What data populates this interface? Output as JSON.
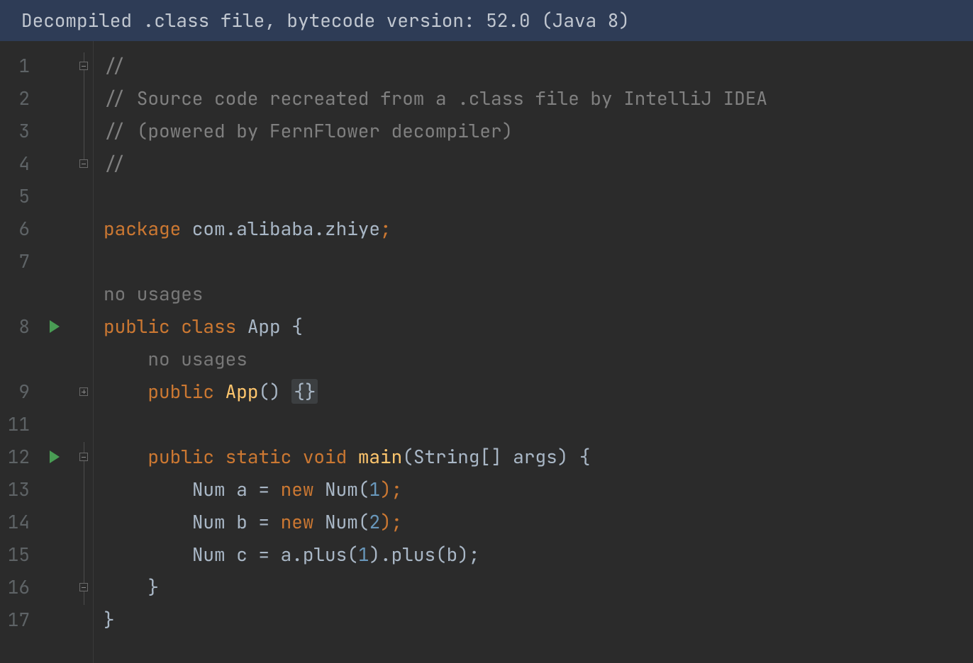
{
  "banner": {
    "text": "Decompiled .class file, bytecode version: 52.0 (Java 8)"
  },
  "gutter": {
    "lines": [
      "1",
      "2",
      "3",
      "4",
      "5",
      "6",
      "7",
      "",
      "8",
      "",
      "9",
      "11",
      "12",
      "13",
      "14",
      "15",
      "16",
      "17"
    ]
  },
  "hints": {
    "no_usages_class": "no usages",
    "no_usages_ctor": "no usages"
  },
  "tokens": {
    "slashes": "//",
    "comment1": "// Source code recreated from a .class file by IntelliJ IDEA",
    "comment2": "// (powered by FernFlower decompiler)",
    "package_kw": "package",
    "package_name": " com.alibaba.zhiye",
    "semi": ";",
    "public_kw": "public",
    "class_kw": " class",
    "app_name": " App",
    "space_brace": " {",
    "ctor_name": " App",
    "parens_empty": "()",
    "space": " ",
    "fold_braces": "{}",
    "static_kw": " static",
    "void_kw": " void",
    "main_name": " main",
    "lparen": "(",
    "string_arr": "String[]",
    "args": " args",
    "rparen_brace": ") {",
    "num_type": "Num",
    "a_eq": " a = ",
    "new_kw": "new",
    "num_ctor": " Num",
    "one": "1",
    "rparen_semi": ");",
    "b_eq": " b = ",
    "two": "2",
    "c_eq": " c = a.plus(",
    "dot_plus_b": ").plus(b);",
    "rbrace": "}",
    "ind1": "    ",
    "ind2": "        ",
    "ind3": "            "
  }
}
